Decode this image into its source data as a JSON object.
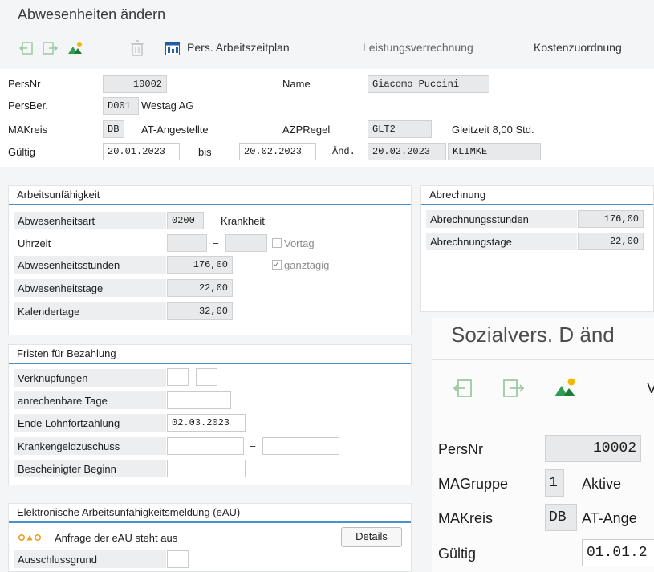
{
  "window": {
    "title": "Abwesenheiten ändern"
  },
  "toolbar": {
    "pers_arbeitszeitplan": "Pers. Arbeitszeitplan",
    "leistungsverrechnung": "Leistungsverrechnung",
    "kostenzuordnung": "Kostenzuordnung"
  },
  "header": {
    "persnr_label": "PersNr",
    "persnr": "10002",
    "name_label": "Name",
    "name": "Giacomo Puccini",
    "persber_label": "PersBer.",
    "persber": "D001",
    "persber_text": "Westag AG",
    "makreis_label": "MAKreis",
    "makreis": "DB",
    "makreis_text": "AT-Angestellte",
    "azpregel_label": "AZPRegel",
    "azpregel": "GLT2",
    "azpregel_text": "Gleitzeit 8,00 Std.",
    "gueltig_label": "Gültig",
    "gueltig_from": "20.01.2023",
    "bis_label": "bis",
    "gueltig_to": "20.02.2023",
    "aend_label": "Änd.",
    "aend_date": "20.02.2023",
    "aend_user": "KLIMKE"
  },
  "arbeitsunfaehigkeit": {
    "title": "Arbeitsunfähigkeit",
    "abwesenheitsart_label": "Abwesenheitsart",
    "abwesenheitsart": "0200",
    "abwesenheitsart_text": "Krankheit",
    "uhrzeit_label": "Uhrzeit",
    "dash": "–",
    "vortag_label": "Vortag",
    "abwesenheitsstunden_label": "Abwesenheitsstunden",
    "abwesenheitsstunden": "176,00",
    "ganztaegig_label": "ganztägig",
    "abwesenheitstage_label": "Abwesenheitstage",
    "abwesenheitstage": "22,00",
    "kalendertage_label": "Kalendertage",
    "kalendertage": "32,00"
  },
  "abrechnung": {
    "title": "Abrechnung",
    "stunden_label": "Abrechnungsstunden",
    "stunden": "176,00",
    "tage_label": "Abrechnungstage",
    "tage": "22,00"
  },
  "fristen": {
    "title": "Fristen für Bezahlung",
    "verknuepfungen_label": "Verknüpfungen",
    "anrechenbare_label": "anrechenbare Tage",
    "ende_label": "Ende Lohnfortzahlung",
    "ende": "02.03.2023",
    "krankengeld_label": "Krankengeldzuschuss",
    "dash": "–",
    "beginn_label": "Bescheinigter Beginn"
  },
  "eau": {
    "title": "Elektronische Arbeitsunfähigkeitsmeldung (eAU)",
    "status_text": "Anfrage der eAU steht aus",
    "details_button": "Details",
    "ausschluss_label": "Ausschlussgrund"
  },
  "overlay": {
    "title": "Sozialvers. D änd",
    "toolbar_letter": "V",
    "persnr_label": "PersNr",
    "persnr": "10002",
    "magruppe_label": "MAGruppe",
    "magruppe": "1",
    "magruppe_text": "Aktive",
    "makreis_label": "MAKreis",
    "makreis": "DB",
    "makreis_text": "AT-Ange",
    "gueltig_label": "Gültig",
    "gueltig": "01.01.2"
  },
  "colors": {
    "accent": "#4a90c9",
    "green_icon": "#2e9d4f",
    "yellow_icon": "#f2b705"
  }
}
